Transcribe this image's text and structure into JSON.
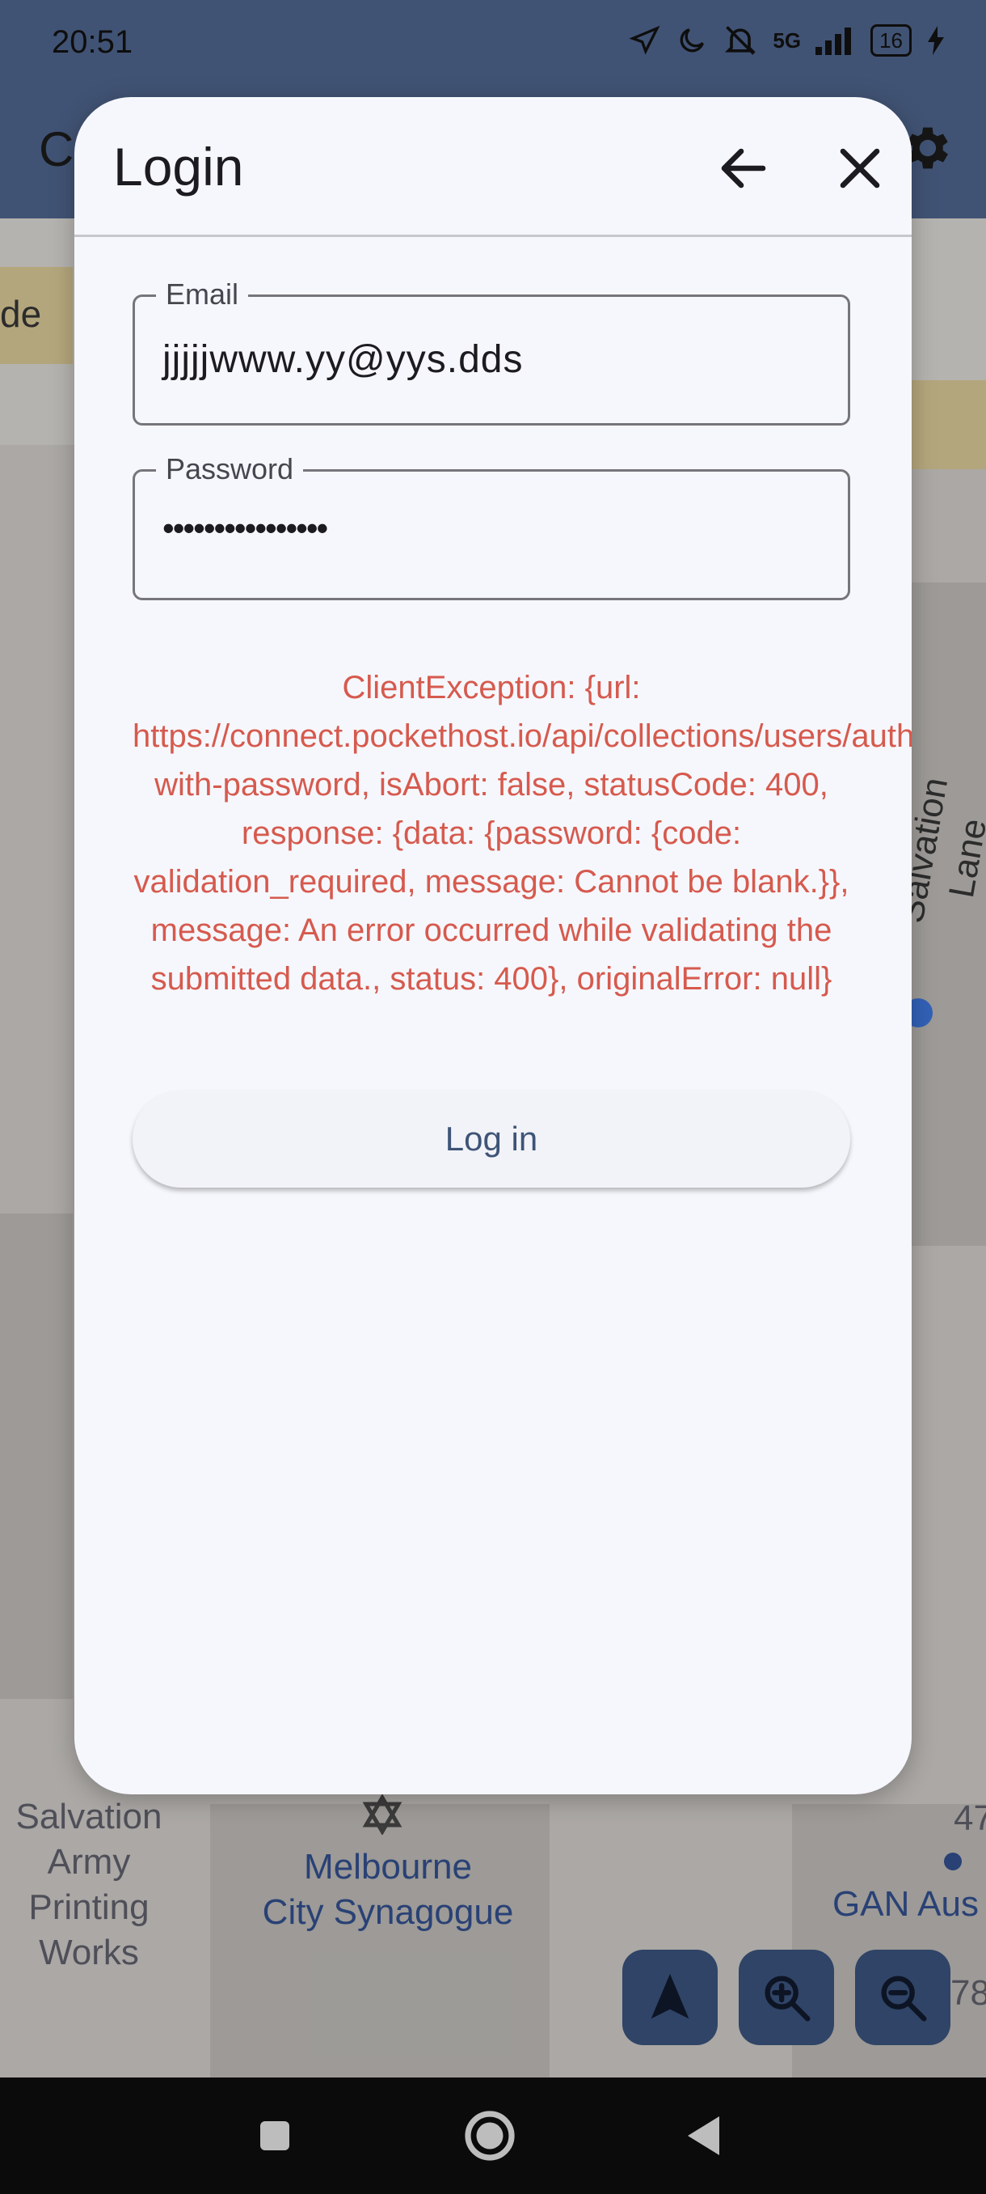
{
  "status_bar": {
    "time": "20:51",
    "battery": "16",
    "network": "5G"
  },
  "app_bar": {
    "title_fragment": "C"
  },
  "map": {
    "labels": [
      "Salvation\nArmy\nPrinting\nWorks",
      "Melbourne\nCity Synagogue",
      "GAN Aus",
      "Salvation Lane",
      "de",
      "47",
      "78"
    ]
  },
  "dialog": {
    "title": "Login",
    "email": {
      "label": "Email",
      "value": "jjjjjwww.yy@yys.dds"
    },
    "password": {
      "label": "Password",
      "value": "••••••••••••••••"
    },
    "error_text": "ClientException: {url: https://connect.pockethost.io/api/collections/users/auth-with-password, isAbort: false, statusCode: 400, response: {data: {password: {code: validation_required, message: Cannot be blank.}}, message: An error occurred while validating the submitted data., status: 400}, originalError: null}",
    "login_button": "Log in"
  },
  "icons": {
    "back": "arrow-left-icon",
    "close": "close-icon",
    "settings": "gear-icon",
    "navigate": "navigation-arrow-icon",
    "zoom_in": "zoom-in-icon",
    "zoom_out": "zoom-out-icon"
  },
  "colors": {
    "error": "#d65a4e",
    "dialog_bg": "#f6f7fc",
    "app_bar": "#4a5f85",
    "fab": "#2f4466",
    "button_text": "#3e5477"
  }
}
